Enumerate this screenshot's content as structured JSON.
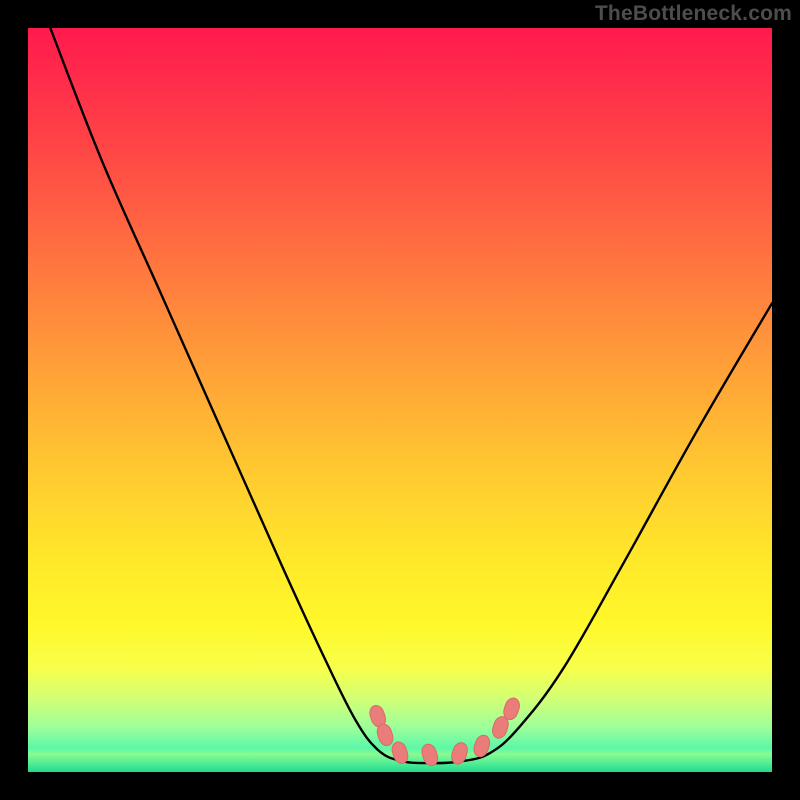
{
  "watermark": "TheBottleneck.com",
  "colors": {
    "curve_stroke": "#000000",
    "marker_fill": "#ea7c79",
    "marker_stroke": "#d86a68",
    "background_black": "#000000"
  },
  "chart_data": {
    "type": "line",
    "title": "",
    "xlabel": "",
    "ylabel": "",
    "xlim": [
      0,
      100
    ],
    "ylim": [
      0,
      100
    ],
    "note": "Axes are implicit (no ticks or labels shown). Curve depicts a bottleneck/compatibility valley. y≈0 is optimal (green band); higher y toward the red zone is worse. The minimum (flat trough) sits roughly between x≈48 and x≈62.",
    "series": [
      {
        "name": "bottleneck-curve",
        "x": [
          3,
          10,
          18,
          26,
          34,
          40,
          44,
          47,
          50,
          54,
          58,
          62,
          66,
          72,
          80,
          90,
          100
        ],
        "y": [
          100,
          82,
          64,
          46,
          28,
          15,
          7,
          3,
          1.5,
          1.2,
          1.4,
          2.5,
          6,
          14,
          28,
          46,
          63
        ]
      }
    ],
    "markers": {
      "name": "trough-markers",
      "points": [
        {
          "x": 47.0,
          "y": 7.5
        },
        {
          "x": 48.0,
          "y": 5.0
        },
        {
          "x": 50.0,
          "y": 2.6
        },
        {
          "x": 54.0,
          "y": 2.3
        },
        {
          "x": 58.0,
          "y": 2.5
        },
        {
          "x": 61.0,
          "y": 3.5
        },
        {
          "x": 63.5,
          "y": 6.0
        },
        {
          "x": 65.0,
          "y": 8.5
        }
      ]
    }
  }
}
